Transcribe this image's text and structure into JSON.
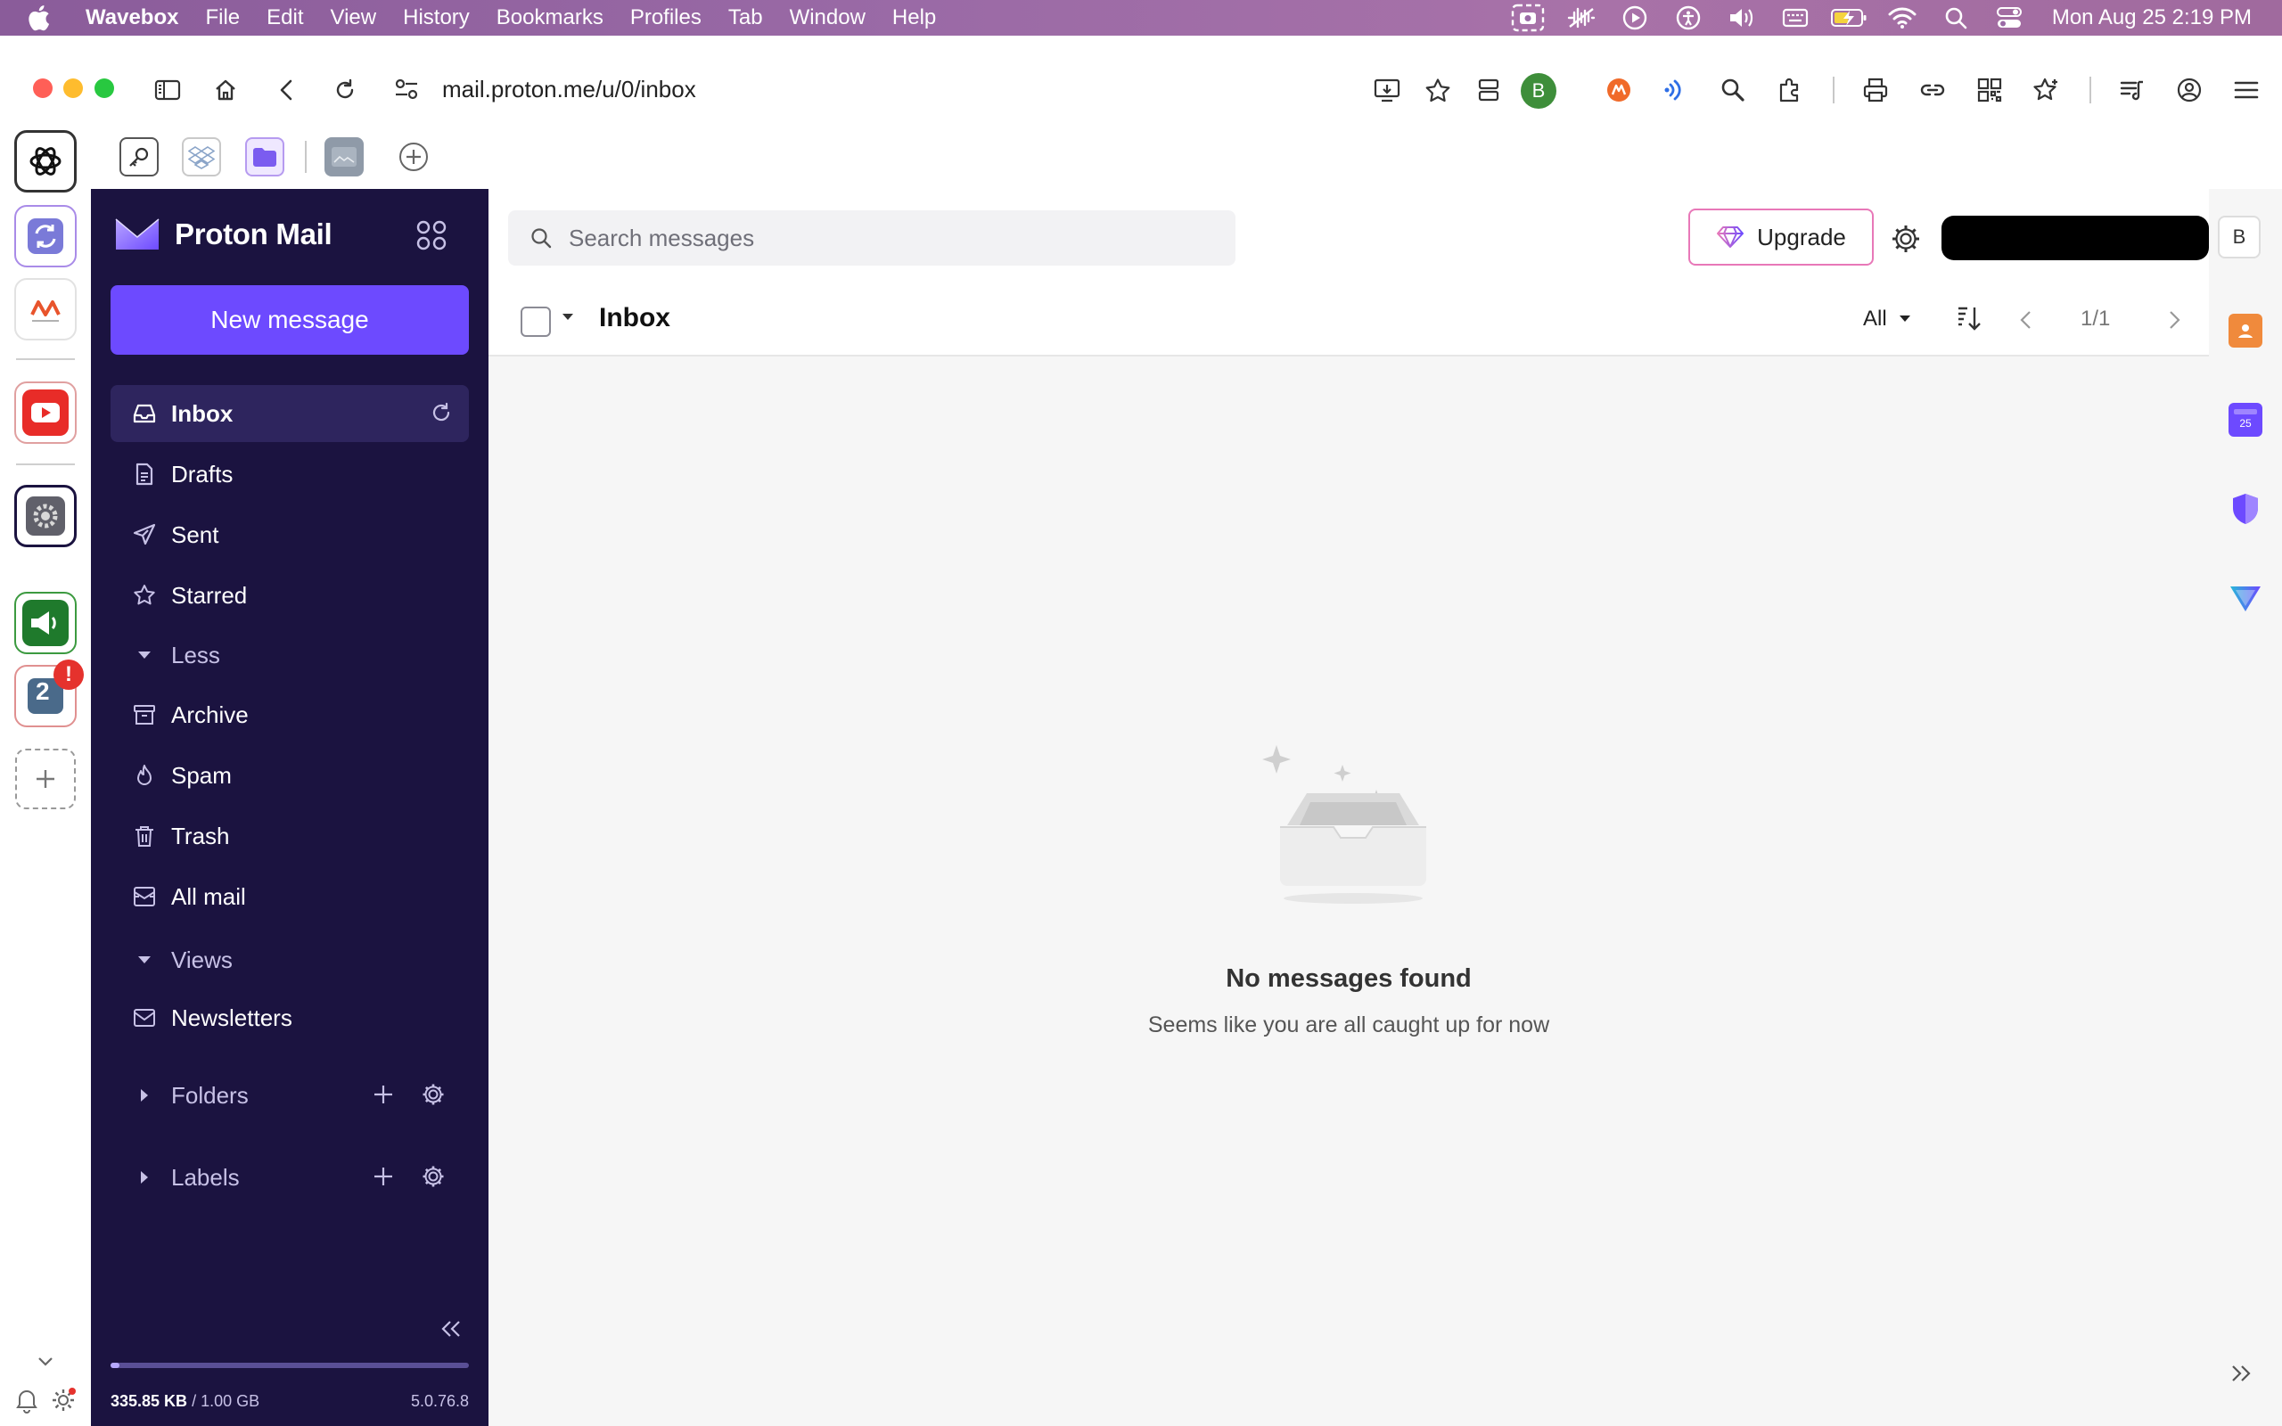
{
  "menubar": {
    "app_name": "Wavebox",
    "items": [
      "File",
      "Edit",
      "View",
      "History",
      "Bookmarks",
      "Profiles",
      "Tab",
      "Window",
      "Help"
    ],
    "clock": "Mon Aug 25  2:19 PM"
  },
  "browser": {
    "url": "mail.proton.me/u/0/inbox",
    "profile_initial": "B"
  },
  "sidebar": {
    "brand": "Proton Mail",
    "new_message": "New message",
    "items": [
      {
        "label": "Inbox",
        "icon": "inbox-icon",
        "active": true
      },
      {
        "label": "Drafts",
        "icon": "drafts-icon"
      },
      {
        "label": "Sent",
        "icon": "send-icon"
      },
      {
        "label": "Starred",
        "icon": "star-icon"
      },
      {
        "label": "Archive",
        "icon": "archive-icon"
      },
      {
        "label": "Spam",
        "icon": "fire-icon"
      },
      {
        "label": "Trash",
        "icon": "trash-icon"
      },
      {
        "label": "All mail",
        "icon": "all-mail-icon"
      },
      {
        "label": "Newsletters",
        "icon": "envelope-icon"
      }
    ],
    "less_label": "Less",
    "views_label": "Views",
    "folders_label": "Folders",
    "labels_label": "Labels",
    "storage_used": "335.85 KB",
    "storage_total": "/ 1.00 GB",
    "storage_fraction": 0.0003,
    "version": "5.0.76.8"
  },
  "topbar": {
    "search_placeholder": "Search messages",
    "upgrade": "Upgrade",
    "account_initial": "B"
  },
  "list": {
    "title": "Inbox",
    "filter": "All",
    "pagination": "1/1"
  },
  "empty": {
    "title": "No messages found",
    "subtitle": "Seems like you are all caught up for now"
  },
  "dock": {
    "badge_count": "2",
    "alert_badge": "!"
  },
  "colors": {
    "accent": "#6d4aff",
    "sidebar_bg": "#1b1340",
    "menubar": "#9a6aa6"
  }
}
